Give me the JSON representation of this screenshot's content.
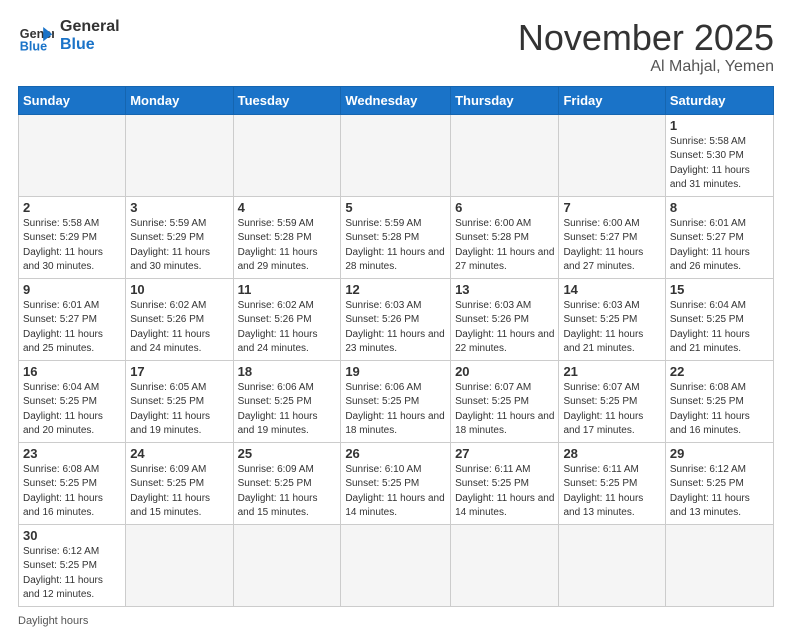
{
  "header": {
    "logo_general": "General",
    "logo_blue": "Blue",
    "month_title": "November 2025",
    "location": "Al Mahjal, Yemen"
  },
  "weekdays": [
    "Sunday",
    "Monday",
    "Tuesday",
    "Wednesday",
    "Thursday",
    "Friday",
    "Saturday"
  ],
  "weeks": [
    [
      {
        "day": "",
        "info": ""
      },
      {
        "day": "",
        "info": ""
      },
      {
        "day": "",
        "info": ""
      },
      {
        "day": "",
        "info": ""
      },
      {
        "day": "",
        "info": ""
      },
      {
        "day": "",
        "info": ""
      },
      {
        "day": "1",
        "info": "Sunrise: 5:58 AM\nSunset: 5:30 PM\nDaylight: 11 hours\nand 31 minutes."
      }
    ],
    [
      {
        "day": "2",
        "info": "Sunrise: 5:58 AM\nSunset: 5:29 PM\nDaylight: 11 hours\nand 30 minutes."
      },
      {
        "day": "3",
        "info": "Sunrise: 5:59 AM\nSunset: 5:29 PM\nDaylight: 11 hours\nand 30 minutes."
      },
      {
        "day": "4",
        "info": "Sunrise: 5:59 AM\nSunset: 5:28 PM\nDaylight: 11 hours\nand 29 minutes."
      },
      {
        "day": "5",
        "info": "Sunrise: 5:59 AM\nSunset: 5:28 PM\nDaylight: 11 hours\nand 28 minutes."
      },
      {
        "day": "6",
        "info": "Sunrise: 6:00 AM\nSunset: 5:28 PM\nDaylight: 11 hours\nand 27 minutes."
      },
      {
        "day": "7",
        "info": "Sunrise: 6:00 AM\nSunset: 5:27 PM\nDaylight: 11 hours\nand 27 minutes."
      },
      {
        "day": "8",
        "info": "Sunrise: 6:01 AM\nSunset: 5:27 PM\nDaylight: 11 hours\nand 26 minutes."
      }
    ],
    [
      {
        "day": "9",
        "info": "Sunrise: 6:01 AM\nSunset: 5:27 PM\nDaylight: 11 hours\nand 25 minutes."
      },
      {
        "day": "10",
        "info": "Sunrise: 6:02 AM\nSunset: 5:26 PM\nDaylight: 11 hours\nand 24 minutes."
      },
      {
        "day": "11",
        "info": "Sunrise: 6:02 AM\nSunset: 5:26 PM\nDaylight: 11 hours\nand 24 minutes."
      },
      {
        "day": "12",
        "info": "Sunrise: 6:03 AM\nSunset: 5:26 PM\nDaylight: 11 hours\nand 23 minutes."
      },
      {
        "day": "13",
        "info": "Sunrise: 6:03 AM\nSunset: 5:26 PM\nDaylight: 11 hours\nand 22 minutes."
      },
      {
        "day": "14",
        "info": "Sunrise: 6:03 AM\nSunset: 5:25 PM\nDaylight: 11 hours\nand 21 minutes."
      },
      {
        "day": "15",
        "info": "Sunrise: 6:04 AM\nSunset: 5:25 PM\nDaylight: 11 hours\nand 21 minutes."
      }
    ],
    [
      {
        "day": "16",
        "info": "Sunrise: 6:04 AM\nSunset: 5:25 PM\nDaylight: 11 hours\nand 20 minutes."
      },
      {
        "day": "17",
        "info": "Sunrise: 6:05 AM\nSunset: 5:25 PM\nDaylight: 11 hours\nand 19 minutes."
      },
      {
        "day": "18",
        "info": "Sunrise: 6:06 AM\nSunset: 5:25 PM\nDaylight: 11 hours\nand 19 minutes."
      },
      {
        "day": "19",
        "info": "Sunrise: 6:06 AM\nSunset: 5:25 PM\nDaylight: 11 hours\nand 18 minutes."
      },
      {
        "day": "20",
        "info": "Sunrise: 6:07 AM\nSunset: 5:25 PM\nDaylight: 11 hours\nand 18 minutes."
      },
      {
        "day": "21",
        "info": "Sunrise: 6:07 AM\nSunset: 5:25 PM\nDaylight: 11 hours\nand 17 minutes."
      },
      {
        "day": "22",
        "info": "Sunrise: 6:08 AM\nSunset: 5:25 PM\nDaylight: 11 hours\nand 16 minutes."
      }
    ],
    [
      {
        "day": "23",
        "info": "Sunrise: 6:08 AM\nSunset: 5:25 PM\nDaylight: 11 hours\nand 16 minutes."
      },
      {
        "day": "24",
        "info": "Sunrise: 6:09 AM\nSunset: 5:25 PM\nDaylight: 11 hours\nand 15 minutes."
      },
      {
        "day": "25",
        "info": "Sunrise: 6:09 AM\nSunset: 5:25 PM\nDaylight: 11 hours\nand 15 minutes."
      },
      {
        "day": "26",
        "info": "Sunrise: 6:10 AM\nSunset: 5:25 PM\nDaylight: 11 hours\nand 14 minutes."
      },
      {
        "day": "27",
        "info": "Sunrise: 6:11 AM\nSunset: 5:25 PM\nDaylight: 11 hours\nand 14 minutes."
      },
      {
        "day": "28",
        "info": "Sunrise: 6:11 AM\nSunset: 5:25 PM\nDaylight: 11 hours\nand 13 minutes."
      },
      {
        "day": "29",
        "info": "Sunrise: 6:12 AM\nSunset: 5:25 PM\nDaylight: 11 hours\nand 13 minutes."
      }
    ],
    [
      {
        "day": "30",
        "info": "Sunrise: 6:12 AM\nSunset: 5:25 PM\nDaylight: 11 hours\nand 12 minutes."
      },
      {
        "day": "",
        "info": ""
      },
      {
        "day": "",
        "info": ""
      },
      {
        "day": "",
        "info": ""
      },
      {
        "day": "",
        "info": ""
      },
      {
        "day": "",
        "info": ""
      },
      {
        "day": "",
        "info": ""
      }
    ]
  ],
  "footer": "Daylight hours"
}
